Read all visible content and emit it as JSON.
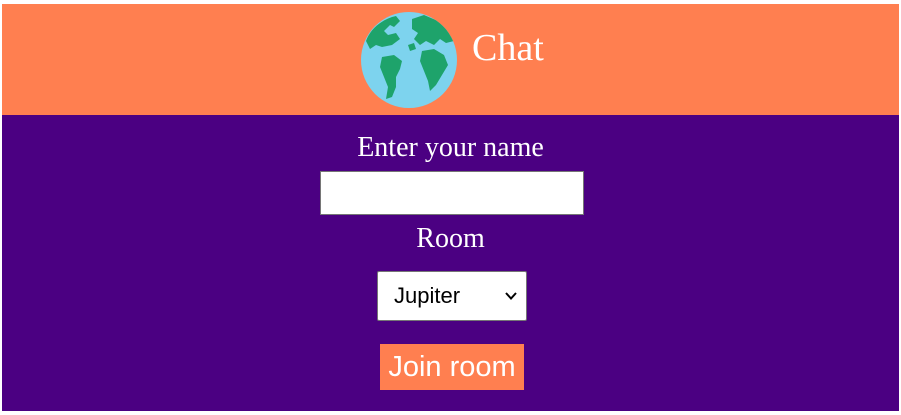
{
  "header": {
    "title": "Chat",
    "logo_icon": "globe-icon",
    "background_color": "#FF7F50"
  },
  "form": {
    "background_color": "#4B0082",
    "name_label": "Enter your name",
    "name_value": "",
    "room_label": "Room",
    "room_selected": "Jupiter",
    "join_label": "Join room",
    "button_color": "#FF7F50"
  }
}
